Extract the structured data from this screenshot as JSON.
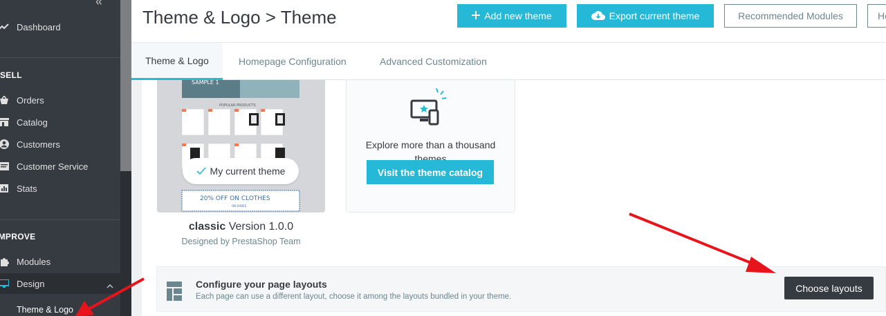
{
  "sidebar": {
    "collapse_glyph": "«",
    "items_top": [
      {
        "label": "Dashboard",
        "icon": "trending-up-icon"
      }
    ],
    "sections": {
      "sell": "SELL",
      "improve": "IMPROVE"
    },
    "sell_items": [
      {
        "label": "Orders",
        "icon": "basket-icon"
      },
      {
        "label": "Catalog",
        "icon": "store-icon"
      },
      {
        "label": "Customers",
        "icon": "account-circle-icon"
      },
      {
        "label": "Customer Service",
        "icon": "chat-icon"
      },
      {
        "label": "Stats",
        "icon": "bar-chart-icon"
      }
    ],
    "improve_items": [
      {
        "label": "Modules",
        "icon": "puzzle-icon"
      },
      {
        "label": "Design",
        "icon": "desktop-icon"
      }
    ],
    "design_sub": {
      "label": "Theme & Logo"
    }
  },
  "header": {
    "title": "Theme & Logo > Theme",
    "add_theme": "Add new theme",
    "export_theme": "Export current theme",
    "recommended": "Recommended Modules",
    "help_partial": "He"
  },
  "tabs": [
    {
      "label": "Theme & Logo",
      "active": true
    },
    {
      "label": "Homepage Configuration",
      "active": false
    },
    {
      "label": "Advanced Customization",
      "active": false
    }
  ],
  "current_theme": {
    "pill_label": "My current theme",
    "name": "classic",
    "version": "Version 1.0.0",
    "author": "Designed by PrestaShop Team",
    "thumb_banner": "SAMPLE 1",
    "thumb_products_label": "POPULAR PRODUCTS",
    "thumb_promo": "20% OFF ON CLOTHES",
    "thumb_promo_sub": "ON SHOES"
  },
  "catalog_card": {
    "text": "Explore more than a thousand themes",
    "button": "Visit the theme catalog"
  },
  "layouts": {
    "title": "Configure your page layouts",
    "description": "Each page can use a different layout, choose it among the layouts bundled in your theme.",
    "button": "Choose layouts"
  },
  "colors": {
    "primary": "#25b9d7",
    "sidebar": "#363a41",
    "annotation_arrow": "#e8141b"
  }
}
